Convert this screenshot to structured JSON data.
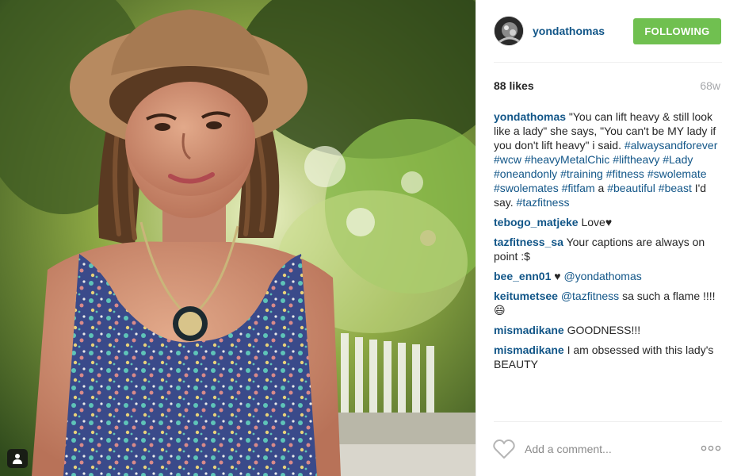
{
  "post": {
    "author": "yondathomas",
    "follow_label": "FOLLOWING",
    "likes": "88 likes",
    "time_ago": "68w"
  },
  "caption": {
    "user": "yondathomas",
    "text": " \"You can lift heavy & still look like a lady\" she says, \"You can't be MY lady if you don't lift heavy\" i said. ",
    "tags_1": [
      "#alwaysandforever",
      "#wcw",
      "#heavyMetalChic",
      "#liftheavy",
      "#Lady",
      "#oneandonly",
      "#training",
      "#fitness",
      "#swolemate",
      "#swolemates",
      "#fitfam"
    ],
    "mid": " a ",
    "tags_2": [
      "#beautiful",
      "#beast"
    ],
    "tail": " I'd say. ",
    "tags_3": [
      "#tazfitness"
    ]
  },
  "comments": [
    {
      "user": "tebogo_matjeke",
      "text": " Love♥"
    },
    {
      "user": "tazfitness_sa",
      "text": " Your captions are always on point :$"
    },
    {
      "user": "bee_enn01",
      "text": " ♥ ",
      "mention": "@yondathomas"
    },
    {
      "user": "keitumetsee",
      "text": " ",
      "mention": "@tazfitness",
      "after": " sa such a flame !!!!😄"
    },
    {
      "user": "mismadikane",
      "text": " GOODNESS!!!"
    },
    {
      "user": "mismadikane",
      "text": " I am obsessed with this lady's BEAUTY"
    }
  ],
  "comment_box": {
    "placeholder": "Add a comment..."
  },
  "icons": {
    "like": "heart-icon",
    "more": "more-options-icon",
    "tag": "person-tag-icon"
  },
  "colors": {
    "link": "#125688",
    "follow_button": "#70c050",
    "muted": "#a5a7aa"
  }
}
